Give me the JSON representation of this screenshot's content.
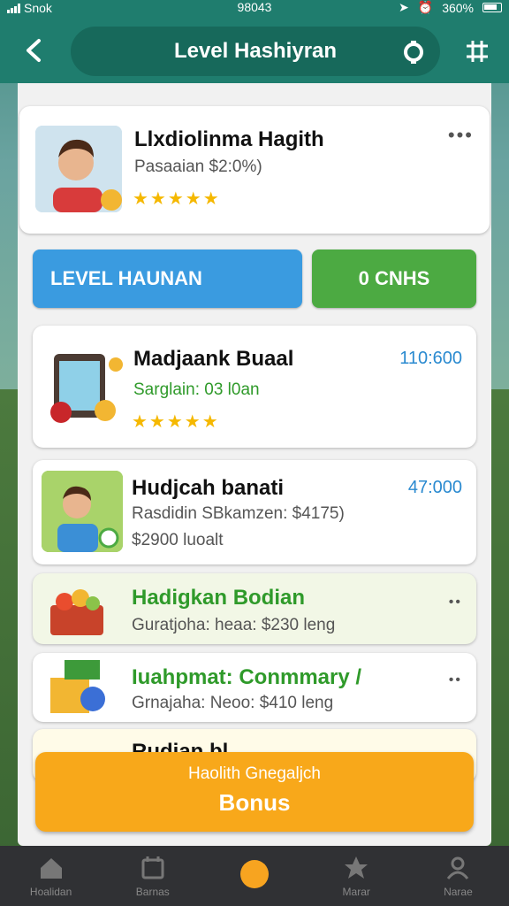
{
  "status": {
    "carrier": "Snok",
    "time": "98043",
    "battery": "360%"
  },
  "header": {
    "title": "Level Hashiyran"
  },
  "profile": {
    "name": "Llxdiolinma Hagith",
    "subtitle": "Pasaaian $2:0%)",
    "rating": 4.5,
    "stars": "★★★★★"
  },
  "buttons": {
    "left": "LEVEL HAUNAN",
    "right": "0 CNHS"
  },
  "items": [
    {
      "name": "Madjaank Buaal",
      "sub": "Sarglain: 03 l0an",
      "price": "110:600",
      "stars": "★★★★★"
    },
    {
      "name": "Hudjcah banati",
      "sub": "Rasdidin SBkamzen: $4175)",
      "sub2": "$2900 luoalt",
      "price": "47:000"
    },
    {
      "name": "Hadigkan Bodian",
      "sub": "Guratjoha: heaa: $230 leng"
    },
    {
      "name": "Iuahpmat: Conmmary /",
      "sub": "Grnajaha: Neoo: $410 leng"
    },
    {
      "name": "Rudian bl..."
    }
  ],
  "bonus": {
    "line1": "Haolith Gnegaljch",
    "line2": "Bonus"
  },
  "nav": [
    {
      "label": "Hoalidan",
      "icon": "home-icon"
    },
    {
      "label": "Barnas",
      "icon": "calendar-icon"
    },
    {
      "label": "",
      "icon": "coin-icon"
    },
    {
      "label": "Marar",
      "icon": "star-icon"
    },
    {
      "label": "Narae",
      "icon": "profile-icon"
    }
  ],
  "colors": {
    "header": "#1f7d6e",
    "blue": "#3a9be0",
    "green": "#4caa42",
    "orange": "#f8a81a"
  }
}
